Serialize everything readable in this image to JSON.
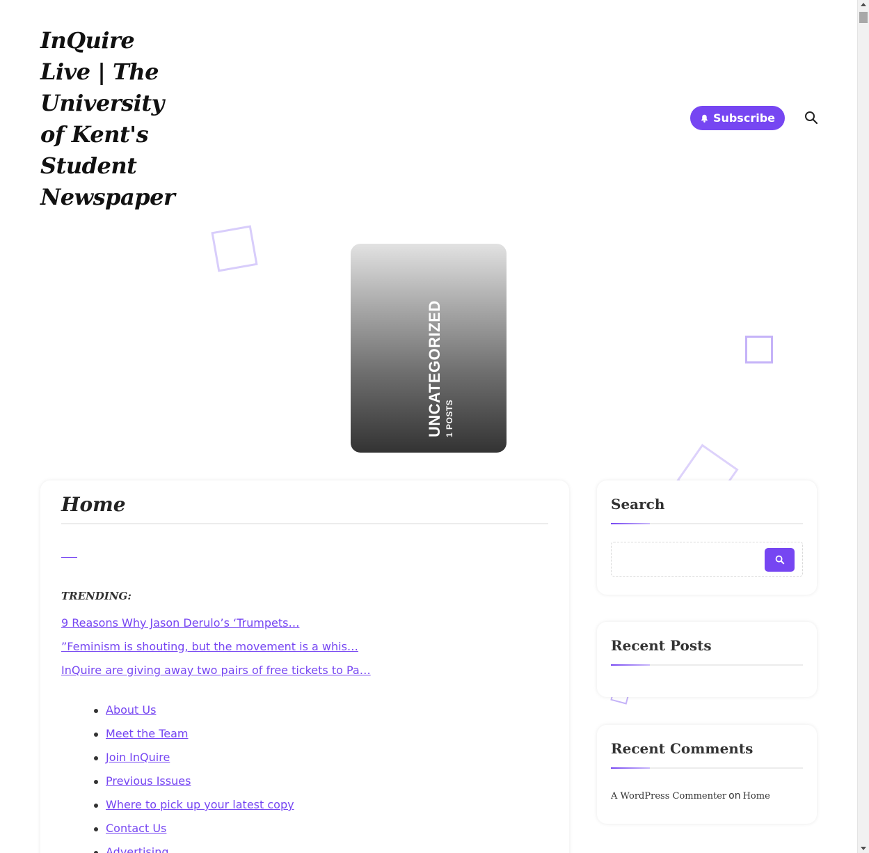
{
  "site": {
    "title": "InQuire Live | The University of Kent's Student Newspaper"
  },
  "header": {
    "subscribe_label": "Subscribe",
    "search_icon": "search-icon",
    "bell_icon": "bell-icon"
  },
  "category_card": {
    "name": "UNCATEGORIZED",
    "count": "1 POSTS"
  },
  "main": {
    "title": "Home",
    "trending_label": "TRENDING:",
    "trending": [
      "9 Reasons Why Jason Derulo’s ‘Trumpets…",
      "”Feminism is shouting, but the movement is a whis…",
      "InQuire are giving away two pairs of free tickets to Pa…"
    ],
    "menu": [
      "About Us",
      "Meet the Team",
      "Join InQuire",
      "Previous Issues",
      "Where to pick up your latest copy",
      "Contact Us",
      "Advertising"
    ]
  },
  "sidebar": {
    "search": {
      "title": "Search",
      "placeholder": ""
    },
    "recent_posts": {
      "title": "Recent Posts"
    },
    "recent_comments": {
      "title": "Recent Comments",
      "author": "A WordPress Commenter",
      "on": "on",
      "post": "Home"
    }
  },
  "colors": {
    "accent": "#7646f2",
    "decor": "#d8cdfb"
  }
}
